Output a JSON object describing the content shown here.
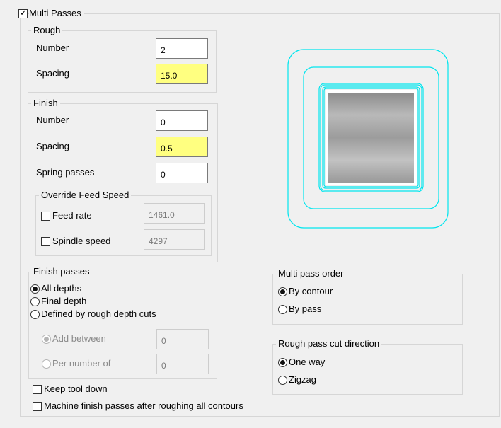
{
  "multi_passes": {
    "label": "Multi Passes",
    "checked": true
  },
  "rough": {
    "title": "Rough",
    "number_label": "Number",
    "number_value": "2",
    "spacing_label": "Spacing",
    "spacing_value": "15.0"
  },
  "finish": {
    "title": "Finish",
    "number_label": "Number",
    "number_value": "0",
    "spacing_label": "Spacing",
    "spacing_value": "0.5",
    "spring_label": "Spring passes",
    "spring_value": "0",
    "override": {
      "title": "Override Feed Speed",
      "feed_label": "Feed rate",
      "feed_value": "1461.0",
      "feed_checked": false,
      "spindle_label": "Spindle speed",
      "spindle_value": "4297",
      "spindle_checked": false
    }
  },
  "finish_passes": {
    "title": "Finish passes",
    "options": [
      "All depths",
      "Final depth",
      "Defined by rough depth cuts"
    ],
    "selected": "All depths",
    "add_between_label": "Add between",
    "add_between_value": "0",
    "per_number_label": "Per number of",
    "per_number_value": "0"
  },
  "multi_pass_order": {
    "title": "Multi pass order",
    "options": [
      "By contour",
      "By pass"
    ],
    "selected": "By contour"
  },
  "rough_direction": {
    "title": "Rough pass cut direction",
    "options": [
      "One way",
      "Zigzag"
    ],
    "selected": "One way"
  },
  "keep_tool_down": {
    "label": "Keep tool down",
    "checked": false
  },
  "machine_finish": {
    "label": "Machine finish passes after roughing all contours",
    "checked": false
  },
  "preview": {
    "contour_color": "#00e5ee",
    "material_color": "#a8a8a8"
  }
}
